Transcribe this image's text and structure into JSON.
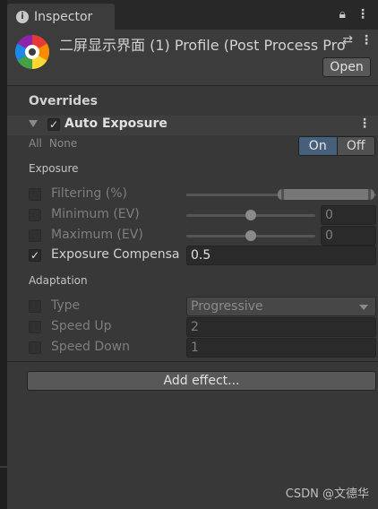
{
  "tab": {
    "icon": "info-icon",
    "title": "Inspector"
  },
  "header": {
    "title": "二屏显示界面 (1) Profile (Post Process Pro",
    "open_label": "Open"
  },
  "overrides_label": "Overrides",
  "effect": {
    "name": "Auto Exposure",
    "enabled": true,
    "all_label": "All",
    "none_label": "None",
    "on_label": "On",
    "off_label": "Off",
    "toggle_state": "On"
  },
  "exposure_section": {
    "label": "Exposure",
    "rows": [
      {
        "label": "Filtering (%)",
        "checked": false,
        "control": "range"
      },
      {
        "label": "Minimum (EV)",
        "checked": false,
        "control": "slider",
        "value": "0"
      },
      {
        "label": "Maximum (EV)",
        "checked": false,
        "control": "slider",
        "value": "0"
      },
      {
        "label": "Exposure Compensa",
        "checked": true,
        "control": "field",
        "value": "0.5"
      }
    ]
  },
  "adaptation_section": {
    "label": "Adaptation",
    "rows": [
      {
        "label": "Type",
        "checked": false,
        "control": "dropdown",
        "value": "Progressive"
      },
      {
        "label": "Speed Up",
        "checked": false,
        "control": "field",
        "value": "2"
      },
      {
        "label": "Speed Down",
        "checked": false,
        "control": "field",
        "value": "1"
      }
    ]
  },
  "add_effect_label": "Add effect...",
  "watermark": "CSDN @文德华",
  "colors": {
    "accent_on": "#46607c",
    "panel": "#383838",
    "background": "#282828"
  }
}
